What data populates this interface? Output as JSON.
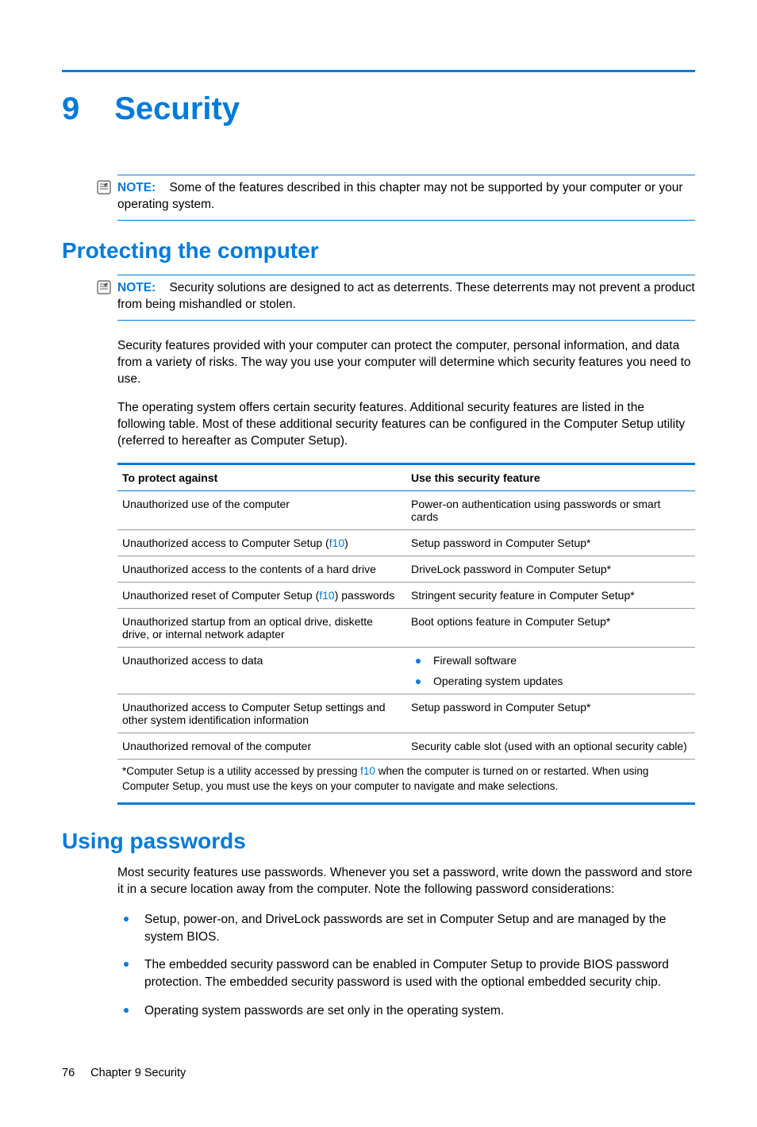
{
  "chapter": {
    "number": "9",
    "title": "Security"
  },
  "note1": {
    "label": "NOTE:",
    "text": "Some of the features described in this chapter may not be supported by your computer or your operating system."
  },
  "section1": {
    "heading": "Protecting the computer"
  },
  "note2": {
    "label": "NOTE:",
    "text": "Security solutions are designed to act as deterrents. These deterrents may not prevent a product from being mishandled or stolen."
  },
  "para1": "Security features provided with your computer can protect the computer, personal information, and data from a variety of risks. The way you use your computer will determine which security features you need to use.",
  "para2": "The operating system offers certain security features. Additional security features are listed in the following table. Most of these additional security features can be configured in the Computer Setup utility (referred to hereafter as Computer Setup).",
  "table": {
    "headers": {
      "col1": "To protect against",
      "col2": "Use this security feature"
    },
    "rows": [
      {
        "threat": {
          "pre": "Unauthorized use of the computer",
          "link": "",
          "post": ""
        },
        "feature_text": "Power-on authentication using passwords or smart cards"
      },
      {
        "threat": {
          "pre": "Unauthorized access to Computer Setup (",
          "link": "f10",
          "post": ")"
        },
        "feature_text": "Setup password in Computer Setup*"
      },
      {
        "threat": {
          "pre": "Unauthorized access to the contents of a hard drive",
          "link": "",
          "post": ""
        },
        "feature_text": "DriveLock password in Computer Setup*"
      },
      {
        "threat": {
          "pre": "Unauthorized reset of Computer Setup (",
          "link": "f10",
          "post": ") passwords"
        },
        "feature_text": "Stringent security feature in Computer Setup*"
      },
      {
        "threat": {
          "pre": "Unauthorized startup from an optical drive, diskette drive, or internal network adapter",
          "link": "",
          "post": ""
        },
        "feature_text": "Boot options feature in Computer Setup*"
      },
      {
        "threat": {
          "pre": "Unauthorized access to data",
          "link": "",
          "post": ""
        },
        "feature_list": [
          "Firewall software",
          "Operating system updates"
        ]
      },
      {
        "threat": {
          "pre": "Unauthorized access to Computer Setup settings and other system identification information",
          "link": "",
          "post": ""
        },
        "feature_text": "Setup password in Computer Setup*"
      },
      {
        "threat": {
          "pre": "Unauthorized removal of the computer",
          "link": "",
          "post": ""
        },
        "feature_text": "Security cable slot (used with an optional security cable)"
      }
    ],
    "footnote": {
      "pre": "*Computer Setup is a utility accessed by pressing ",
      "link": "f10",
      "post": " when the computer is turned on or restarted. When using Computer Setup, you must use the keys on your computer to navigate and make selections."
    }
  },
  "section2": {
    "heading": "Using passwords"
  },
  "para3": "Most security features use passwords. Whenever you set a password, write down the password and store it in a secure location away from the computer. Note the following password considerations:",
  "bullets": [
    "Setup, power-on, and DriveLock passwords are set in Computer Setup and are managed by the system BIOS.",
    "The embedded security password can be enabled in Computer Setup to provide BIOS password protection. The embedded security password is used with the optional embedded security chip.",
    "Operating system passwords are set only in the operating system."
  ],
  "footer": {
    "page": "76",
    "label": "Chapter 9   Security"
  }
}
